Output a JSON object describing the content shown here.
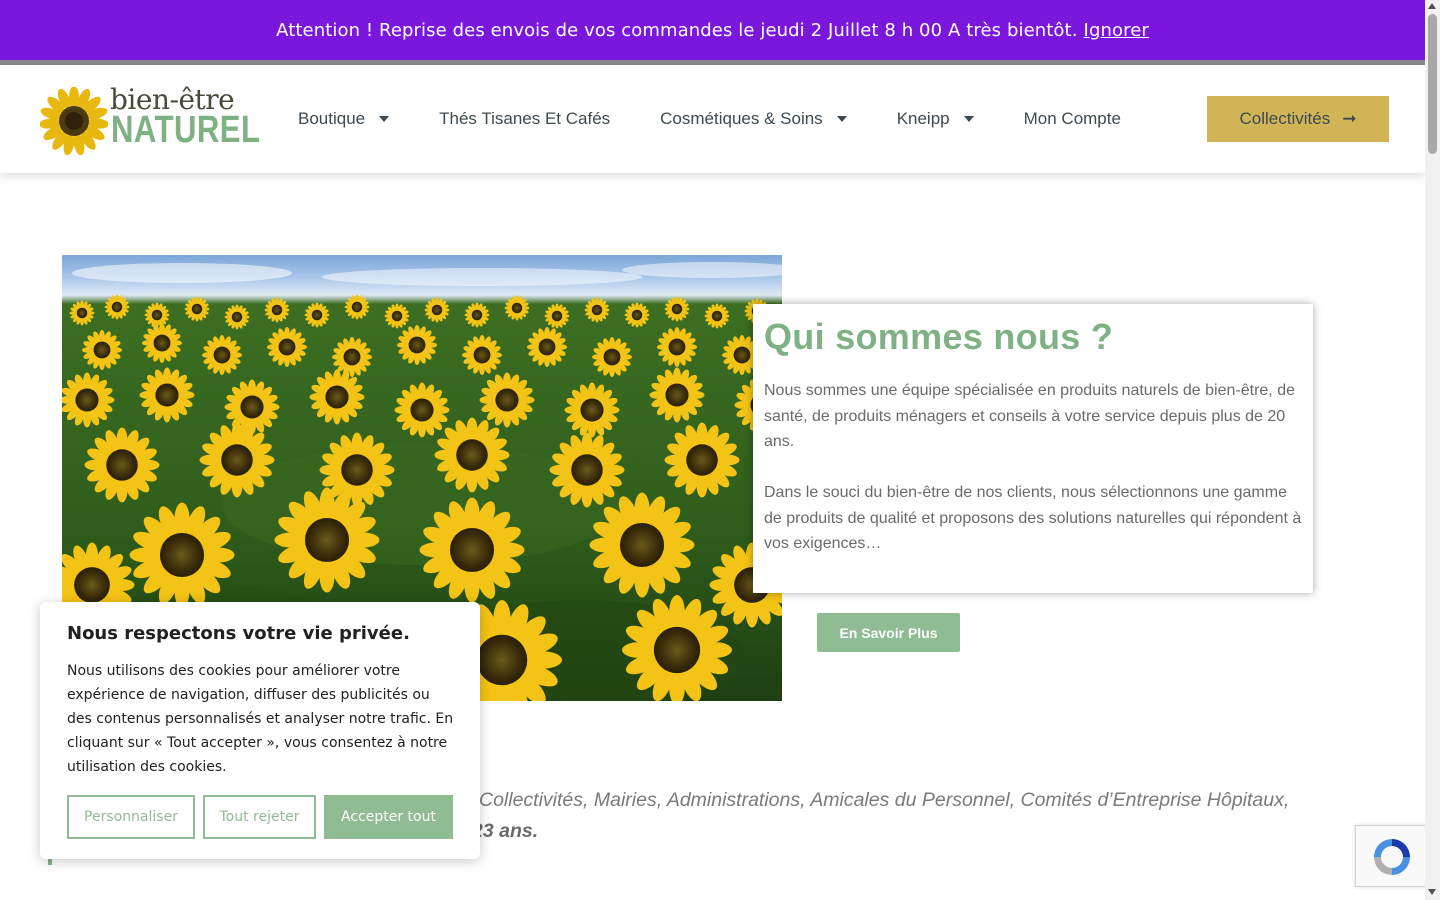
{
  "announcement": {
    "text": "Attention ! Reprise des envois de vos commandes le jeudi 2 Juillet 8 h 00 A très bientôt.",
    "dismiss_label": "Ignorer",
    "bg_color": "#7b16dc"
  },
  "logo": {
    "line1": "bien-être",
    "line2": "NATUREL",
    "icon": "sunflower-icon"
  },
  "nav": {
    "items": [
      {
        "label": "Boutique",
        "has_dropdown": true
      },
      {
        "label": "Thés Tisanes Et Cafés",
        "has_dropdown": false
      },
      {
        "label": "Cosmétiques & Soins",
        "has_dropdown": true
      },
      {
        "label": "Kneipp",
        "has_dropdown": true
      },
      {
        "label": "Mon Compte",
        "has_dropdown": false
      }
    ],
    "cta_label": "Collectivités",
    "cta_icon": "arrow-right-icon",
    "cta_color": "#d1b456"
  },
  "hero": {
    "image": "sunflower-field",
    "title": "Qui sommes nous ?",
    "paragraph1": "Nous sommes une équipe spécialisée en produits naturels de bien-être, de santé, de produits ménagers et conseils à votre service depuis plus de 20 ans.",
    "paragraph2": "Dans le souci du bien-être de nos clients, nous sélectionnons une gamme de produits de qualité et proposons des solutions naturelles qui répondent à vos exigences…",
    "button_label": "En Savoir Plus",
    "accent_color": "#7fb185"
  },
  "intro_text": {
    "visible_line1": "Collectivités, Mairies, Administrations, Amicales du Personnel, Comités d’Entreprise Hôpitaux,",
    "visible_line2": "23 ans."
  },
  "cookie_banner": {
    "title": "Nous respectons votre vie privée.",
    "body": "Nous utilisons des cookies pour améliorer votre expérience de navigation, diffuser des publicités ou des contenus personnalisés et analyser notre trafic. En cliquant sur « Tout accepter », vous consentez à notre utilisation des cookies.",
    "customize_label": "Personnaliser",
    "reject_label": "Tout rejeter",
    "accept_label": "Accepter tout"
  },
  "recaptcha": {
    "icon": "recaptcha-icon"
  }
}
